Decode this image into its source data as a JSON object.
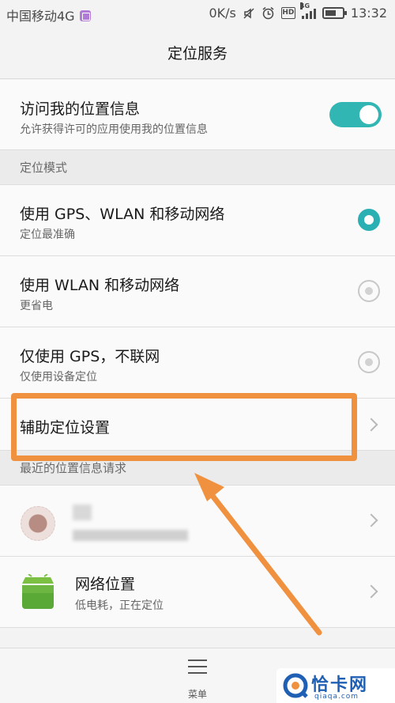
{
  "status_bar": {
    "carrier": "中国移动4G",
    "speed": "0K/s",
    "hd": "HD",
    "network": "4G",
    "time": "13:32",
    "battery_level": 0.65
  },
  "header": {
    "title": "定位服务"
  },
  "location_access": {
    "title": "访问我的位置信息",
    "subtitle": "允许获得许可的应用使用我的位置信息",
    "enabled": true
  },
  "mode_section": {
    "label": "定位模式"
  },
  "modes": [
    {
      "title": "使用 GPS、WLAN 和移动网络",
      "subtitle": "定位最准确",
      "selected": true
    },
    {
      "title": "使用 WLAN 和移动网络",
      "subtitle": "更省电",
      "selected": false
    },
    {
      "title": "仅使用 GPS，不联网",
      "subtitle": "仅使用设备定位",
      "selected": false
    }
  ],
  "assist": {
    "title": "辅助定位设置"
  },
  "recent_section": {
    "label": "最近的位置信息请求"
  },
  "recent": [
    {
      "title": "",
      "subtitle": ""
    },
    {
      "title": "网络位置",
      "subtitle": "低电耗，正在定位"
    }
  ],
  "bottom": {
    "menu_label": "菜单"
  },
  "watermark": {
    "text": "恰卡网",
    "url": "qiaqa.com"
  },
  "colors": {
    "accent": "#32b6b3",
    "highlight": "#f0913f"
  }
}
